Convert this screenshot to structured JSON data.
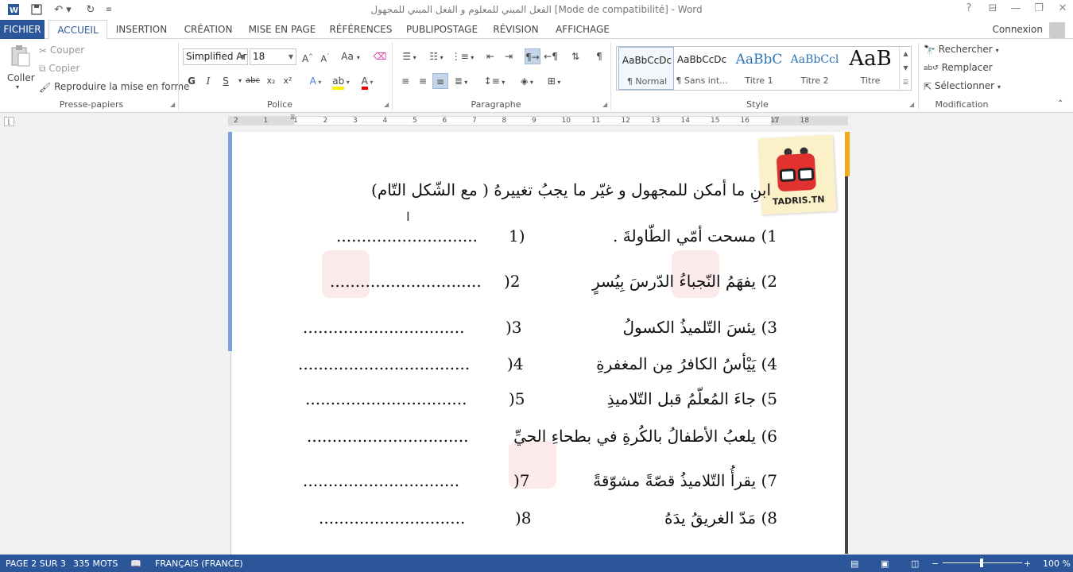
{
  "window": {
    "title": "الفعل المبني للمعلوم و الفعل المبني للمجهول [Mode de compatibilité] - Word",
    "controls": [
      "?",
      "⊟",
      "—",
      "❐",
      "✕"
    ]
  },
  "ribbon_tabs": [
    "FICHIER",
    "ACCUEIL",
    "INSERTION",
    "CRÉATION",
    "MISE EN PAGE",
    "RÉFÉRENCES",
    "PUBLIPOSTAGE",
    "RÉVISION",
    "AFFICHAGE"
  ],
  "active_tab": "ACCUEIL",
  "signin_label": "Connexion",
  "clipboard": {
    "paste_label": "Coller",
    "cut_label": "Couper",
    "copy_label": "Copier",
    "format_painter_label": "Reproduire la mise en forme",
    "group_label": "Presse-papiers"
  },
  "font": {
    "font_name": "Simplified Ar",
    "font_size": "18",
    "group_label": "Police",
    "case_label": "Aa",
    "bold": "G",
    "italic": "I",
    "underline": "S",
    "strike": "abc",
    "subscript": "x₂",
    "superscript": "x²"
  },
  "paragraph": {
    "group_label": "Paragraphe"
  },
  "styles": {
    "group_label": "Style",
    "items": [
      {
        "sample": "AaBbCcDc",
        "label": "¶ Normal"
      },
      {
        "sample": "AaBbCcDc",
        "label": "¶ Sans int..."
      },
      {
        "sample": "AaBbC",
        "label": "Titre 1"
      },
      {
        "sample": "AaBbCcl",
        "label": "Titre 2"
      },
      {
        "sample": "AaB",
        "label": "Titre"
      }
    ]
  },
  "editing": {
    "group_label": "Modification",
    "find_label": "Rechercher",
    "replace_label": "Remplacer",
    "select_label": "Sélectionner"
  },
  "ruler_ticks": [
    "2",
    "1",
    "1",
    "2",
    "3",
    "4",
    "5",
    "6",
    "7",
    "8",
    "9",
    "10",
    "11",
    "12",
    "13",
    "14",
    "15",
    "16",
    "17",
    "18"
  ],
  "document": {
    "instruction": "ابنِ ما أمكن للمجهول و غيّر ما يجبُ تغييرهُ ( مع الشّكل التّام)",
    "logo_text": "TADRIS.TN",
    "items": [
      {
        "sentence": "1) مسحت أمّي الطّاولةَ .",
        "num": "1)",
        "dots": "............................"
      },
      {
        "sentence": "2) يفهَمُ النّجباءُ الدّرسَ بِيُسرٍ",
        "num": ")2",
        "dots": ".............................."
      },
      {
        "sentence": "3) يئسَ التّلميذُ الكسولُ",
        "num": ")3",
        "dots": "................................"
      },
      {
        "sentence": "4) يَيْأسُ الكافرُ مِن المغفرةِ",
        "num": ")4",
        "dots": ".................................."
      },
      {
        "sentence": "5) جاءَ المُعلّمُ قبل التّلاميذِ",
        "num": ")5",
        "dots": "................................"
      },
      {
        "sentence": "6) يلعبُ الأطفالُ بالكُرةِ في بطحاءِ الحيِّ",
        "num": "6)",
        "dots": "................................"
      },
      {
        "sentence": "7) يقرأُ التّلاميذُ قصّةً مشوّقةً",
        "num": ")7",
        "dots": "..............................."
      },
      {
        "sentence": "8) مَدّ الغريقُ يدَهُ",
        "num": ")8",
        "dots": "............................."
      }
    ]
  },
  "statusbar": {
    "page": "PAGE 2 SUR 3",
    "words": "335 MOTS",
    "language": "FRANÇAIS (FRANCE)",
    "zoom": "100 %"
  },
  "colors": {
    "accent": "#2b579a",
    "logo_red": "#e2322f",
    "highlight": "#f0a91e"
  }
}
